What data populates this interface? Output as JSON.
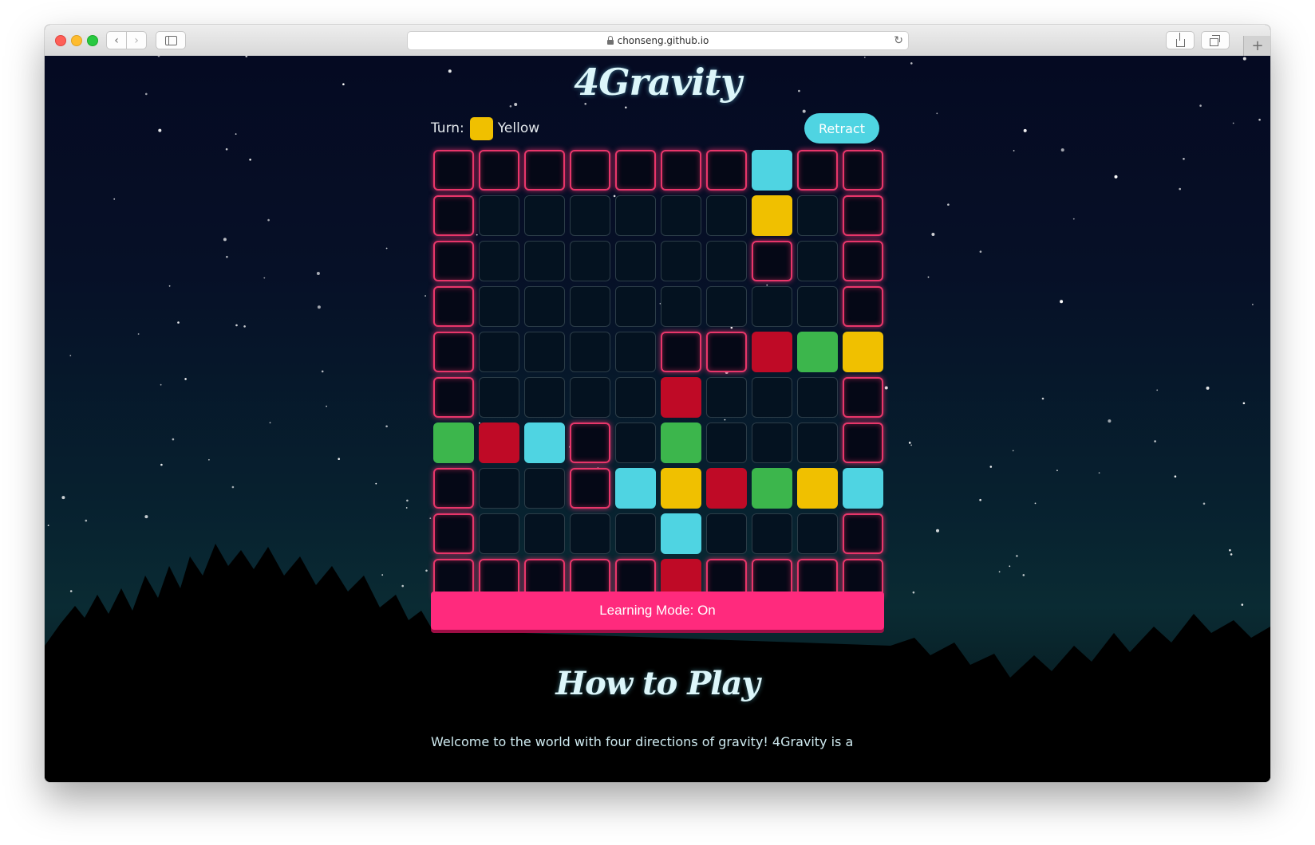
{
  "browser": {
    "url": "chonseng.github.io",
    "reload_glyph": "↻",
    "newtab_glyph": "+",
    "back_glyph": "‹",
    "forward_glyph": "›",
    "icons": [
      "back-arrow-icon",
      "forward-arrow-icon",
      "sidebar-icon",
      "lock-icon",
      "reload-icon",
      "share-icon",
      "tabs-overview-icon",
      "new-tab-icon"
    ]
  },
  "game": {
    "title": "4Gravity",
    "turn_label": "Turn:",
    "turn_player": "Yellow",
    "turn_color": "#f0c000",
    "retract_label": "Retract",
    "learning_mode_label": "Learning Mode: On",
    "board": [
      [
        "W",
        "W",
        "W",
        "W",
        "W",
        "W",
        "W",
        "C",
        "W",
        "W"
      ],
      [
        "W",
        "E",
        "E",
        "E",
        "E",
        "E",
        "E",
        "Y",
        "E",
        "W"
      ],
      [
        "W",
        "E",
        "E",
        "E",
        "E",
        "E",
        "E",
        "W",
        "E",
        "W"
      ],
      [
        "W",
        "E",
        "E",
        "E",
        "E",
        "E",
        "E",
        "E",
        "E",
        "W"
      ],
      [
        "W",
        "E",
        "E",
        "E",
        "E",
        "W",
        "W",
        "R",
        "G",
        "Y"
      ],
      [
        "W",
        "E",
        "E",
        "E",
        "E",
        "R",
        "E",
        "E",
        "E",
        "W"
      ],
      [
        "G",
        "R",
        "C",
        "W",
        "E",
        "G",
        "E",
        "E",
        "E",
        "W"
      ],
      [
        "W",
        "E",
        "E",
        "W",
        "C",
        "Y",
        "R",
        "G",
        "Y",
        "C"
      ],
      [
        "W",
        "E",
        "E",
        "E",
        "E",
        "C",
        "E",
        "E",
        "E",
        "W"
      ],
      [
        "W",
        "W",
        "W",
        "W",
        "W",
        "R",
        "W",
        "W",
        "W",
        "W"
      ]
    ],
    "legend": {
      "W": "wall",
      "E": "empty",
      "Y": "yellow",
      "R": "red",
      "G": "green",
      "C": "cyan"
    },
    "piece_colors": {
      "Y": "#f0c000",
      "R": "#bf0a26",
      "G": "#3cb64c",
      "C": "#4fd4e2"
    }
  },
  "how_to_play": {
    "title": "How to Play",
    "intro": "Welcome to the world with four directions of gravity! 4Gravity is a"
  }
}
